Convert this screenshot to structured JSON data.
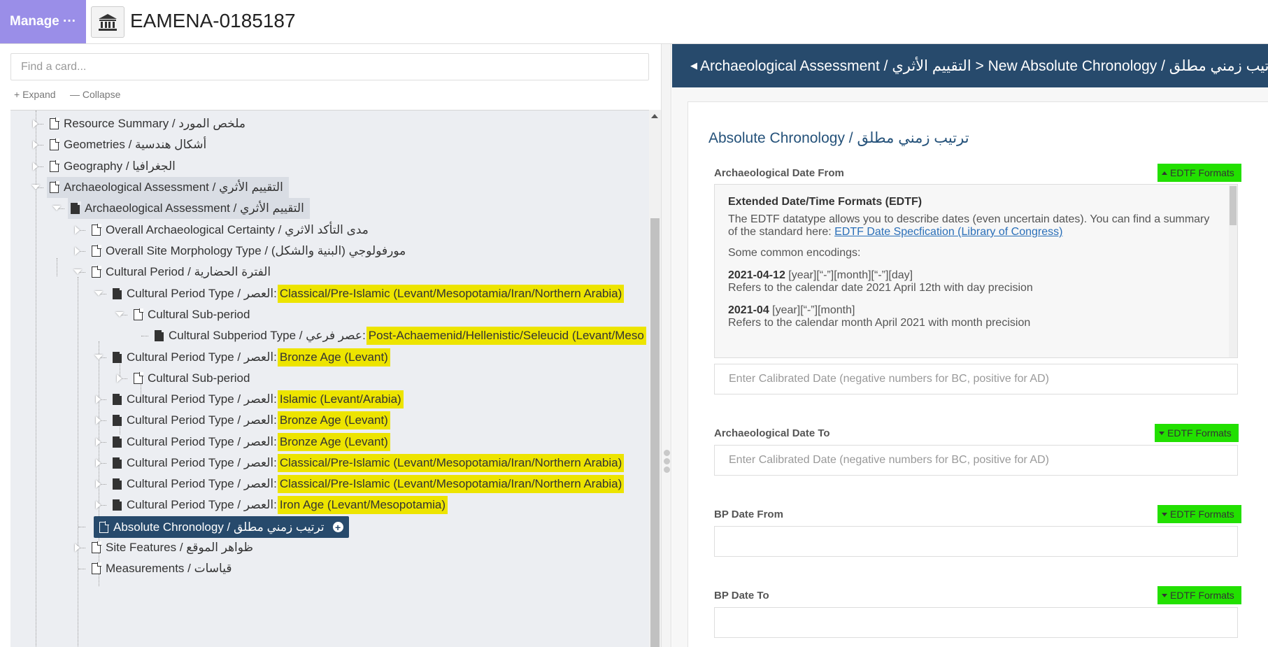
{
  "topbar": {
    "manage_label": "Manage ···",
    "resource_icon": "museum-icon",
    "resource_title": "EAMENA-0185187"
  },
  "sidebar": {
    "search_placeholder": "Find a card...",
    "expand_label": "+ Expand",
    "collapse_label": "— Collapse",
    "tree": [
      {
        "label": "Resource Summary / ملخص المورد"
      },
      {
        "label": "Geometries / أشكال هندسية"
      },
      {
        "label": "Geography / الجغرافيا"
      },
      {
        "label": "Archaeological Assessment / التقييم الأثري"
      },
      {
        "label": "Archaeological Assessment / التقييم الأثري"
      },
      {
        "label": "Overall Archaeological Certainty / مدى التأكد الاثري"
      },
      {
        "label": "Overall Site Morphology Type / مورفولوجي (البنية والشكل)"
      },
      {
        "label": "Cultural Period / الفترة الحضارية"
      },
      {
        "label": "Cultural Period Type / العصر:",
        "value": "Classical/Pre-Islamic (Levant/Mesopotamia/Iran/Northern Arabia)"
      },
      {
        "label": "Cultural Sub-period"
      },
      {
        "label": "Cultural Subperiod Type / عصر فرعي:",
        "value": "Post-Achaemenid/Hellenistic/Seleucid (Levant/Meso"
      },
      {
        "label": "Cultural Period Type / العصر:",
        "value": "Bronze Age (Levant)"
      },
      {
        "label": "Cultural Sub-period"
      },
      {
        "label": "Cultural Period Type / العصر:",
        "value": "Islamic (Levant/Arabia)"
      },
      {
        "label": "Cultural Period Type / العصر:",
        "value": "Bronze Age (Levant)"
      },
      {
        "label": "Cultural Period Type / العصر:",
        "value": "Bronze Age (Levant)"
      },
      {
        "label": "Cultural Period Type / العصر:",
        "value": "Classical/Pre-Islamic (Levant/Mesopotamia/Iran/Northern Arabia)"
      },
      {
        "label": "Cultural Period Type / العصر:",
        "value": "Classical/Pre-Islamic (Levant/Mesopotamia/Iran/Northern Arabia)"
      },
      {
        "label": "Cultural Period Type / العصر:",
        "value": "Iron Age (Levant/Mesopotamia)"
      },
      {
        "label": "Absolute Chronology / ترتيب زمني مطلق"
      },
      {
        "label": "Site Features / ظواهر الموقع"
      },
      {
        "label": "Measurements / قياسات"
      }
    ]
  },
  "main": {
    "breadcrumb": "Archaeological Assessment / التقييم الأثري > New Absolute Chronology / ترتيب زمني مطلق",
    "card_title": "Absolute Chronology / ترتيب زمني مطلق",
    "edtf_label": "EDTF Formats",
    "fields": [
      {
        "label": "Archaeological Date From",
        "placeholder": "Enter Calibrated Date (negative numbers for BC, positive for AD)"
      },
      {
        "label": "Archaeological Date To",
        "placeholder": "Enter Calibrated Date (negative numbers for BC, positive for AD)"
      },
      {
        "label": "BP Date From",
        "placeholder": ""
      },
      {
        "label": "BP Date To",
        "placeholder": ""
      }
    ],
    "help": {
      "title": "Extended Date/Time Formats (EDTF)",
      "body": "The EDTF datatype allows you to describe dates (even uncertain dates). You can find a summary of the standard here:",
      "link": "EDTF Date Specfication (Library of Congress)",
      "common": "Some common encodings:",
      "encodings": [
        {
          "code": "2021-04-12",
          "pattern": "[year][“-”][month][“-”][day]",
          "desc": "Refers to the calendar date 2021 April 12th with day precision"
        },
        {
          "code": "2021-04",
          "pattern": "[year][“-”][month]",
          "desc": "Refers to the calendar month April 2021 with month precision"
        }
      ]
    }
  },
  "colors": {
    "manage_bg": "#9a8ee8",
    "nav_dark": "#274a6c",
    "highlight_yellow": "#ede400",
    "edtf_green": "#22e000",
    "title_blue": "#25527a"
  }
}
